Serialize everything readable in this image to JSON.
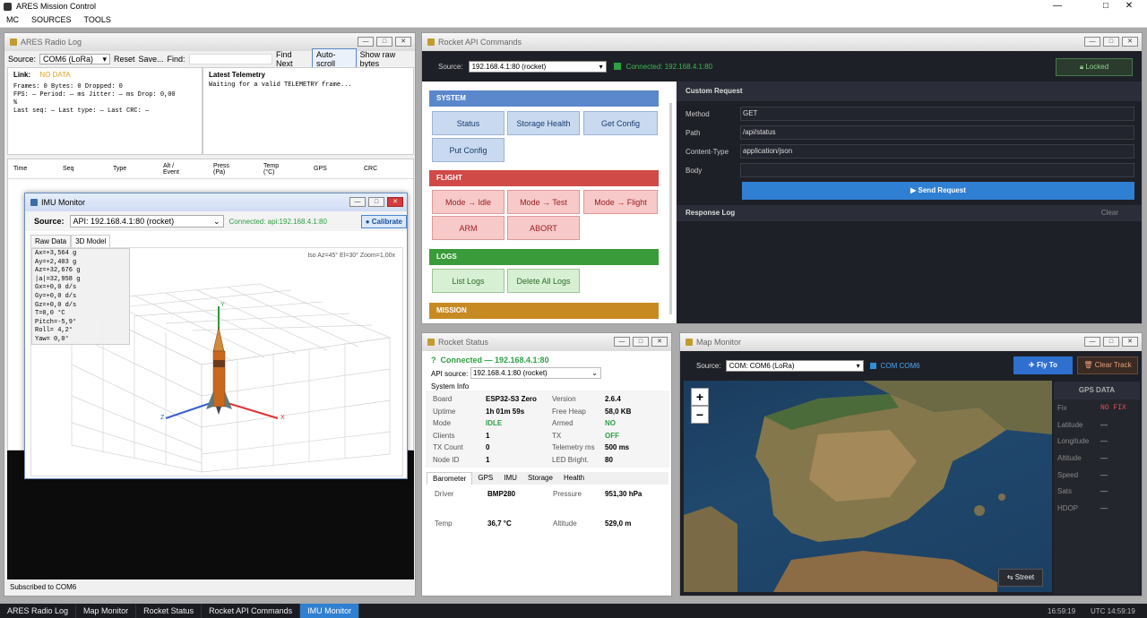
{
  "app": {
    "title": "ARES Mission Control",
    "menu": [
      "MC",
      "SOURCES",
      "TOOLS"
    ]
  },
  "colors": {
    "accent": "#2f7fd2",
    "connected": "#2ea043",
    "system": "#5b87cc",
    "flight": "#d04a48",
    "logs": "#3a9b3a",
    "mission": "#c78a22",
    "nofix": "#e05050"
  },
  "radiolog": {
    "title": "ARES Radio Log",
    "source_label": "Source:",
    "source_value": "COM6 (LoRa)",
    "reset": "Reset",
    "save": "Save...",
    "find": "Find:",
    "find_next": "Find Next",
    "autoscroll": "Auto-scroll",
    "show_raw": "Show raw bytes",
    "link_label": "Link:",
    "link_value": "NO DATA",
    "stats": [
      "Frames: 0   Bytes: 0   Dropped: 0",
      "FPS: —   Period: — ms   Jitter: — ms   Drop: 0,00",
      "%",
      "Last seq: —   Last type: —   Last CRC: —"
    ],
    "telemetry_title": "Latest Telemetry",
    "telemetry_text": "Waiting for a valid TELEMETRY frame...",
    "columns": [
      "Time",
      "Seq",
      "Type",
      "Alt /\nEvent",
      "Press\n(Pa)",
      "Temp\n(°C)",
      "GPS",
      "CRC"
    ],
    "status": "Subscribed to COM6"
  },
  "imu": {
    "title": "IMU Monitor",
    "source_label": "Source:",
    "source_value": "API: 192.168.4.1:80 (rocket)",
    "connected": "Connected: api:192.168.4.1:80",
    "calibrate": "Calibrate",
    "tabs": [
      "Raw Data",
      "3D Model"
    ],
    "view_info": "Iso  Az=45°  El=30°  Zoom=1,00x",
    "readout": [
      "Ax=+3,564 g",
      "Ay=+2,403 g",
      "Az=+32,676 g",
      "|a|=32,958 g",
      "Gx=+0,0 d/s",
      "Gy=+0,0 d/s",
      "Gz=+0,0 d/s",
      "T=0,0 °C",
      "Pitch=-5,9°",
      "Roll= 4,2°",
      "Yaw=  0,0°"
    ],
    "axis_x": "X",
    "axis_y": "Y",
    "axis_z": "Z"
  },
  "api": {
    "title": "Rocket API Commands",
    "source_label": "Source:",
    "source_value": "192.168.4.1:80 (rocket)",
    "connected": "Connected: 192.168.4.1:80",
    "locked": "Locked",
    "groups": {
      "system": "SYSTEM",
      "flight": "FLIGHT",
      "logs": "LOGS",
      "mission": "MISSION"
    },
    "system_buttons": [
      "Status",
      "Storage Health",
      "Get Config",
      "Put Config"
    ],
    "flight_buttons": [
      "Mode → Idle",
      "Mode → Test",
      "Mode → Flight",
      "ARM",
      "ABORT"
    ],
    "logs_buttons": [
      "List Logs",
      "Delete All Logs"
    ],
    "custom": {
      "title": "Custom Request",
      "method_label": "Method",
      "method": "GET",
      "path_label": "Path",
      "path": "/api/status",
      "ct_label": "Content-Type",
      "ct": "application/json",
      "body_label": "Body",
      "send": "Send Request"
    },
    "response_title": "Response Log",
    "clear": "Clear"
  },
  "status": {
    "title": "Rocket Status",
    "connected": "Connected  —  192.168.4.1:80",
    "api_source_label": "API source:",
    "api_source": "192.168.4.1:80  (rocket)",
    "sysinfo": "System Info",
    "left": [
      [
        "Board",
        "ESP32-S3 Zero"
      ],
      [
        "Uptime",
        "1h 01m 59s"
      ],
      [
        "Mode",
        "IDLE"
      ],
      [
        "Clients",
        "1"
      ],
      [
        "TX Count",
        "0"
      ],
      [
        "Node ID",
        "1"
      ]
    ],
    "right": [
      [
        "Version",
        "2.6.4"
      ],
      [
        "Free Heap",
        "58,0 KB"
      ],
      [
        "Armed",
        "NO"
      ],
      [
        "TX",
        "OFF"
      ],
      [
        "Telemetry ms",
        "500 ms"
      ],
      [
        "LED Bright.",
        "80"
      ]
    ],
    "tabs": [
      "Barometer",
      "GPS",
      "IMU",
      "Storage",
      "Health"
    ],
    "baro": [
      [
        "Driver",
        "BMP280"
      ],
      [
        "Pressure",
        "951,30 hPa"
      ],
      [
        "Temp",
        "36,7 °C"
      ],
      [
        "Altitude",
        "529,0 m"
      ]
    ]
  },
  "map": {
    "title": "Map Monitor",
    "source_label": "Source:",
    "source_value": "COM: COM6 (LoRa)",
    "com_label": "COM  COM6",
    "fly_to": "Fly To",
    "clear_track": "Clear Track",
    "zoom_in": "+",
    "zoom_out": "−",
    "street": "Street",
    "gps_title": "GPS DATA",
    "gps": [
      [
        "Fix",
        "NO FIX"
      ],
      [
        "Latitude",
        "—"
      ],
      [
        "Longitude",
        "—"
      ],
      [
        "Altitude",
        "—"
      ],
      [
        "Speed",
        "—"
      ],
      [
        "Sats",
        "—"
      ],
      [
        "HDOP",
        "—"
      ]
    ]
  },
  "taskbar": {
    "items": [
      "ARES Radio Log",
      "Map Monitor",
      "Rocket Status",
      "Rocket API Commands",
      "IMU Monitor"
    ],
    "local_time": "16:59:19",
    "utc_time": "UTC  14:59:19"
  }
}
